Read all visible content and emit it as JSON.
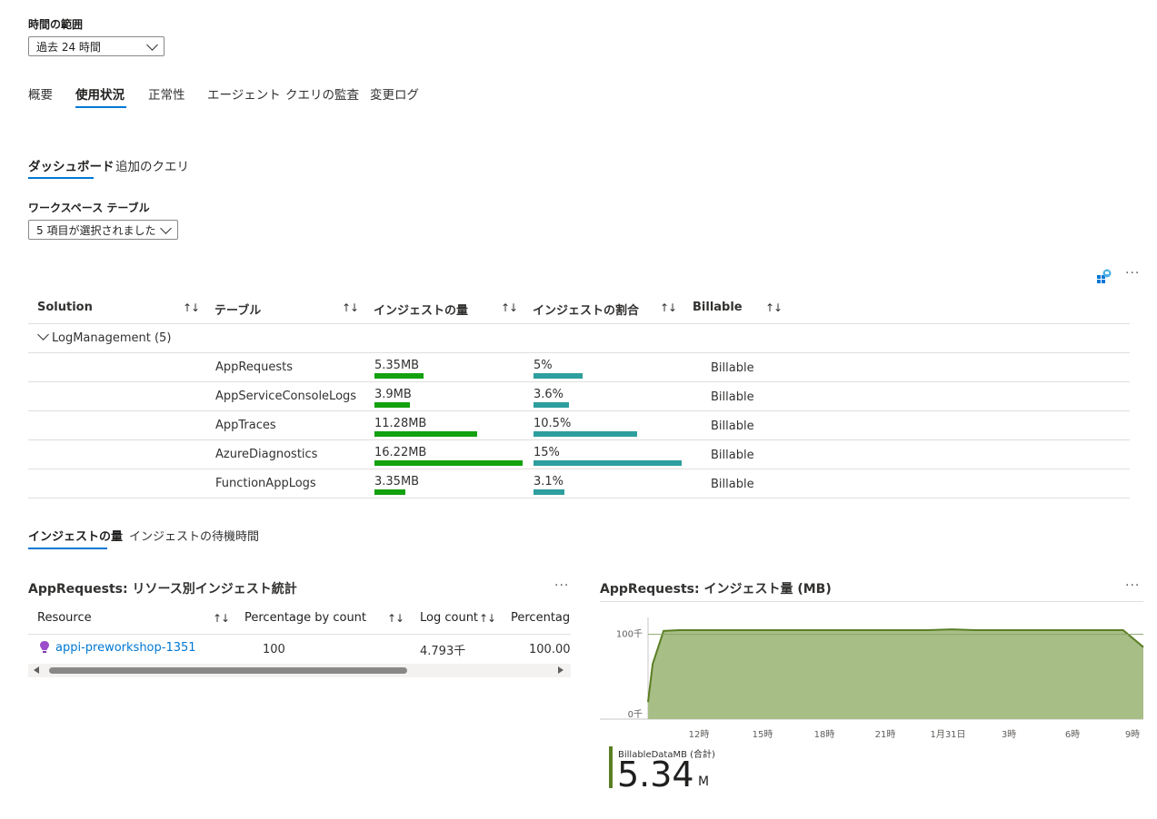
{
  "time_range": {
    "label": "時間の範囲",
    "value": "過去 24 時間"
  },
  "main_tabs": [
    "概要",
    "使用状況",
    "正常性",
    "エージェント",
    "クエリの監査",
    "変更ログ"
  ],
  "sub_tabs": [
    "ダッシュボード",
    "追加のクエリ"
  ],
  "workspace_tables": {
    "label": "ワークスペース テーブル",
    "value": "5 項目が選択されました"
  },
  "table": {
    "headers": [
      "Solution",
      "テーブル",
      "インジェストの量",
      "インジェストの割合",
      "Billable"
    ],
    "group": "LogManagement (5)",
    "rows": [
      {
        "name": "AppRequests",
        "volume": "5.35MB",
        "volume_mb": 5.35,
        "percent": "5%",
        "percent_val": 5,
        "billable": "Billable"
      },
      {
        "name": "AppServiceConsoleLogs",
        "volume": "3.9MB",
        "volume_mb": 3.9,
        "percent": "3.6%",
        "percent_val": 3.6,
        "billable": "Billable"
      },
      {
        "name": "AppTraces",
        "volume": "11.28MB",
        "volume_mb": 11.28,
        "percent": "10.5%",
        "percent_val": 10.5,
        "billable": "Billable"
      },
      {
        "name": "AzureDiagnostics",
        "volume": "16.22MB",
        "volume_mb": 16.22,
        "percent": "15%",
        "percent_val": 15,
        "billable": "Billable"
      },
      {
        "name": "FunctionAppLogs",
        "volume": "3.35MB",
        "volume_mb": 3.35,
        "percent": "3.1%",
        "percent_val": 3.1,
        "billable": "Billable"
      }
    ]
  },
  "lower_tabs": [
    "インジェストの量",
    "インジェストの待機時間"
  ],
  "stats": {
    "title": "AppRequests: リソース別インジェスト統計",
    "headers": [
      "Resource",
      "Percentage by count",
      "Log count",
      "Percentage"
    ],
    "row": {
      "resource": "appi-preworkshop-1351",
      "pct_count": "100",
      "log_count": "4.793千",
      "pct": "100.00"
    }
  },
  "chart": {
    "title": "AppRequests: インジェスト量 (MB)",
    "metric_label": "BillableDataMB (合計)",
    "metric_value": "5.34",
    "metric_unit": "M"
  },
  "chart_data": {
    "type": "area",
    "title": "AppRequests: インジェスト量 (MB)",
    "y_tick_labels": [
      "0千",
      "100千"
    ],
    "ylim": [
      0,
      120
    ],
    "x_tick_labels": [
      "12時",
      "15時",
      "18時",
      "21時",
      "1月31日",
      "3時",
      "6時",
      "9時"
    ],
    "x": [
      0,
      0.3,
      1.0,
      2,
      4,
      6,
      8,
      10,
      12,
      14,
      16,
      18,
      19.5,
      21,
      23,
      25,
      27,
      29,
      30.5,
      31.8
    ],
    "values": [
      20,
      65,
      104,
      105,
      105,
      105,
      105,
      105,
      105,
      105,
      105,
      105,
      106,
      105,
      105,
      105,
      105,
      105,
      105,
      85
    ],
    "color": "#5b7f24",
    "fill": "#a8be87",
    "legend": "BillableDataMB (合計)"
  },
  "colors": {
    "accent": "#0078d4",
    "volume_bar": "#13a10e",
    "percent_bar": "#2e9e9e",
    "area_line": "#5b7f24",
    "area_fill": "#a8be87"
  }
}
